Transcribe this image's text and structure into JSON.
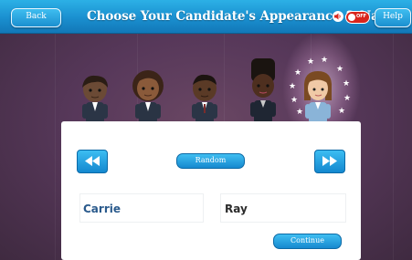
{
  "header": {
    "back_label": "Back",
    "title": "Choose Your Candidate's Appearance & Name",
    "sound_toggle_text": "OFF",
    "help_label": "Help"
  },
  "characters": [
    {
      "name": "character-1",
      "selected": false
    },
    {
      "name": "character-2",
      "selected": false
    },
    {
      "name": "character-3",
      "selected": false
    },
    {
      "name": "character-4",
      "selected": false
    },
    {
      "name": "character-5",
      "selected": true
    }
  ],
  "panel": {
    "random_label": "Random",
    "first_name_value": "Carrie",
    "last_name_value": "Ray",
    "continue_label": "Continue"
  },
  "colors": {
    "header_blue": "#1a8fcf",
    "background_purple": "#57385a",
    "first_name_text": "#2a5a8c",
    "last_name_text": "#2b2b2b",
    "toggle_red": "#d9251c"
  },
  "icons": {
    "prev": "rewind-icon",
    "next": "fast-forward-icon",
    "sound": "speaker-icon"
  }
}
